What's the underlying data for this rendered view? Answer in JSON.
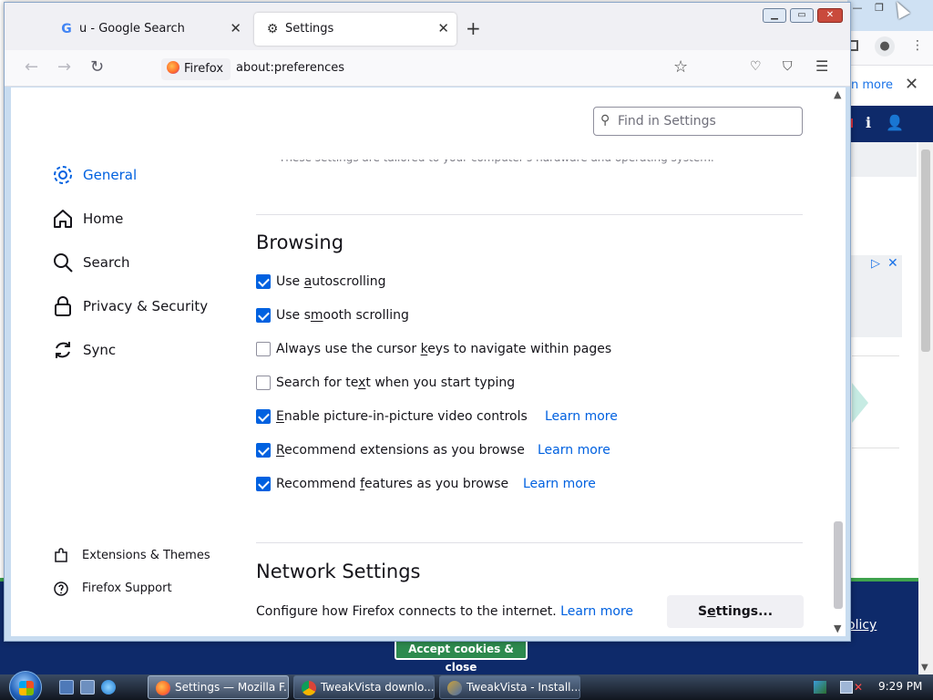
{
  "background_window": {
    "learn_more": "n more",
    "policy_link": "olicy",
    "cookie_button": "Accept cookies & close"
  },
  "browser": {
    "tabs": [
      {
        "title": "u - Google Search",
        "favicon": "google-g-icon"
      },
      {
        "title": "Settings",
        "favicon": "gear-icon"
      }
    ],
    "new_tab": "+",
    "identity_label": "Firefox",
    "url": "about:preferences"
  },
  "settings": {
    "search_placeholder": "Find in Settings",
    "faded_text": "These settings are tailored to your computer's hardware and operating system.",
    "sidebar": {
      "items": [
        {
          "label": "General",
          "icon": "gear-icon"
        },
        {
          "label": "Home",
          "icon": "home-icon"
        },
        {
          "label": "Search",
          "icon": "search-icon"
        },
        {
          "label": "Privacy & Security",
          "icon": "lock-icon"
        },
        {
          "label": "Sync",
          "icon": "sync-icon"
        }
      ],
      "footer": [
        {
          "label": "Extensions & Themes",
          "icon": "puzzle-icon"
        },
        {
          "label": "Firefox Support",
          "icon": "help-icon"
        }
      ]
    },
    "browsing": {
      "heading": "Browsing",
      "options": [
        {
          "pre": "Use ",
          "key": "a",
          "post": "utoscrolling",
          "checked": true,
          "learn": ""
        },
        {
          "pre": "Use s",
          "key": "m",
          "post": "ooth scrolling",
          "checked": true,
          "learn": ""
        },
        {
          "pre": "Always use the cursor ",
          "key": "k",
          "post": "eys to navigate within pages",
          "checked": false,
          "learn": ""
        },
        {
          "pre": "Search for te",
          "key": "x",
          "post": "t when you start typing",
          "checked": false,
          "learn": ""
        },
        {
          "pre": "",
          "key": "E",
          "post": "nable picture-in-picture video controls",
          "checked": true,
          "learn": "Learn more"
        },
        {
          "pre": "",
          "key": "R",
          "post": "ecommend extensions as you browse",
          "checked": true,
          "learn": "Learn more"
        },
        {
          "pre": "Recommend ",
          "key": "f",
          "post": "eatures as you browse",
          "checked": true,
          "learn": "Learn more"
        }
      ]
    },
    "network": {
      "heading": "Network Settings",
      "description": "Configure how Firefox connects to the internet.",
      "learn": "Learn more",
      "button_pre": "S",
      "button_key": "e",
      "button_post": "ttings..."
    }
  },
  "taskbar": {
    "buttons": [
      {
        "label": "Settings — Mozilla F...",
        "active": true,
        "icon": "firefox-icon"
      },
      {
        "label": "TweakVista downlo...",
        "active": false,
        "icon": "chrome-icon"
      },
      {
        "label": "TweakVista - Install...",
        "active": false,
        "icon": "installer-icon"
      }
    ],
    "clock": "9:29 PM"
  },
  "colors": {
    "accent": "#0061e0",
    "checkbox_checked": "#0061e0",
    "page_footer": "#0e2a6a",
    "footer_green": "#3fa34d"
  }
}
